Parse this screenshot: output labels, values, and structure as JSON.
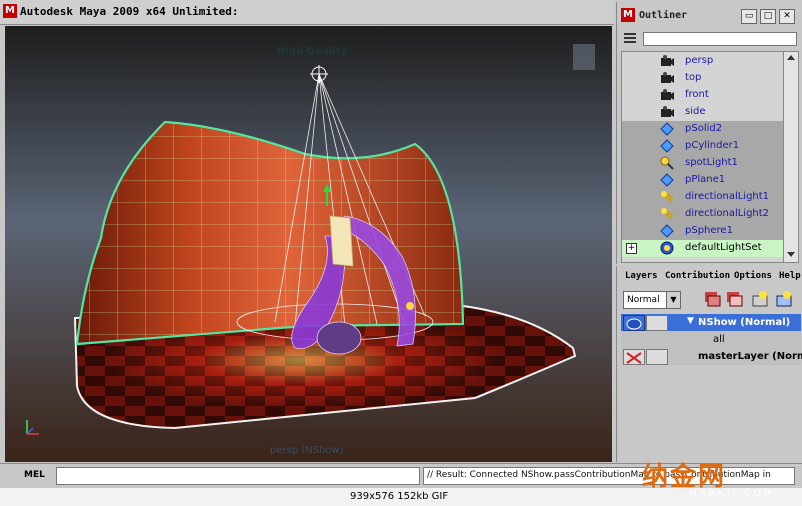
{
  "window": {
    "title": "Autodesk Maya 2009 x64 Unlimited:",
    "logo_glyph": "M"
  },
  "viewport": {
    "render_quality": "High Quality",
    "camera_label": "persp (NShow)"
  },
  "outliner": {
    "title": "Outliner",
    "buttons": {
      "minimize": "▭",
      "maximize": "□",
      "close": "✕"
    },
    "items": [
      {
        "label": "persp",
        "icon": "camera-icon"
      },
      {
        "label": "top",
        "icon": "camera-icon"
      },
      {
        "label": "front",
        "icon": "camera-icon"
      },
      {
        "label": "side",
        "icon": "camera-icon"
      },
      {
        "label": "pSolid2",
        "icon": "mesh-icon"
      },
      {
        "label": "pCylinder1",
        "icon": "mesh-icon"
      },
      {
        "label": "spotLight1",
        "icon": "spotlight-icon"
      },
      {
        "label": "pPlane1",
        "icon": "mesh-icon"
      },
      {
        "label": "directionalLight1",
        "icon": "directional-light-icon"
      },
      {
        "label": "directionalLight2",
        "icon": "directional-light-icon"
      },
      {
        "label": "pSphere1",
        "icon": "mesh-icon"
      },
      {
        "label": "defaultLightSet",
        "icon": "light-set-icon"
      }
    ],
    "expand_glyph": "+"
  },
  "layers": {
    "menu": [
      "Layers",
      "Contribution",
      "Options",
      "Help"
    ],
    "mode": "Normal",
    "rows": [
      {
        "name": "NShow (Normal)",
        "expand": "▼"
      },
      {
        "name": "all"
      },
      {
        "name": "masterLayer (Normal)"
      }
    ]
  },
  "commandline": {
    "label": "MEL",
    "result": "// Result: Connected NShow.passContributionMap to passContributionMap in"
  },
  "statusbar": {
    "text": "939x576 152kb GIF"
  },
  "watermark": {
    "text": "纳金网",
    "sub": "NARKII.COM"
  },
  "colors": {
    "accent_blue": "#3a6fd8",
    "layer_selected": "#3a6fd8",
    "outliner_selected": "#c9f4c4"
  }
}
